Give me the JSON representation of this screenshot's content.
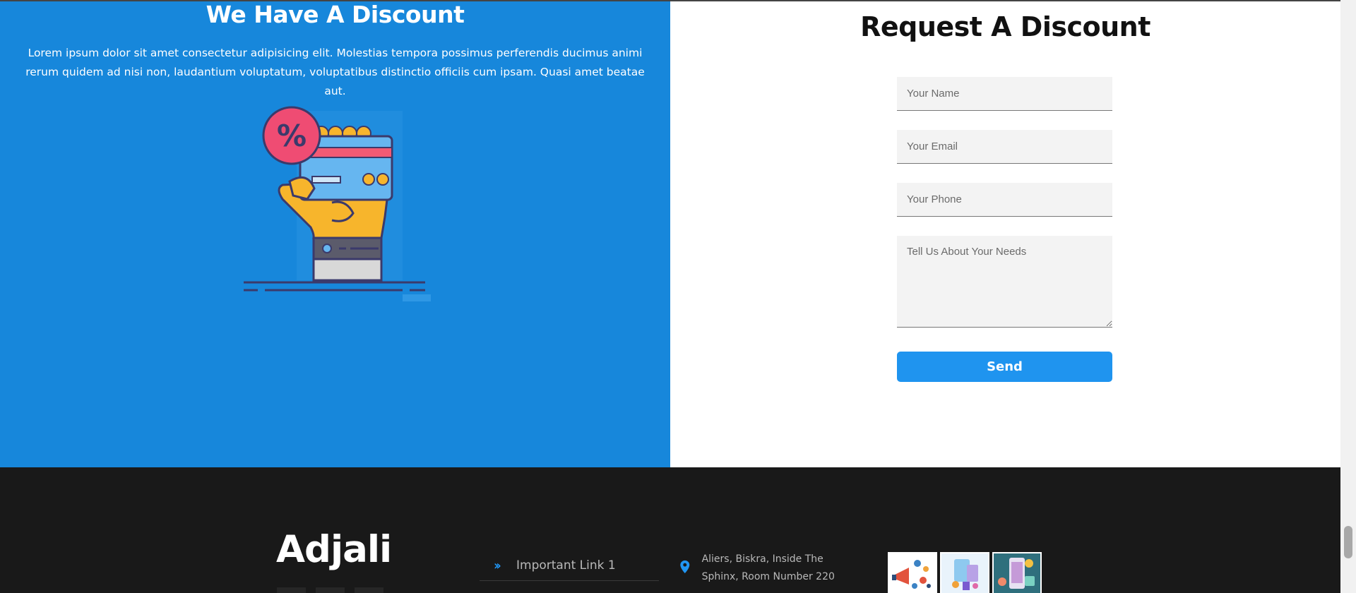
{
  "discount": {
    "title": "We Have A Discount",
    "description": "Lorem ipsum dolor sit amet consectetur adipisicing elit. Molestias tempora possimus perferendis ducimus animi rerum quidem ad nisi non, laudantium voluptatum, voluptatibus distinctio officiis cum ipsam. Quasi amet beatae aut.",
    "illustration_icon": "discount-card-hand-icon",
    "bg_color": "#1787db"
  },
  "request_form": {
    "title": "Request A Discount",
    "name_placeholder": "Your Name",
    "email_placeholder": "Your Email",
    "phone_placeholder": "Your Phone",
    "message_placeholder": "Tell Us About Your Needs",
    "send_label": "Send",
    "button_color": "#1f94ef"
  },
  "footer": {
    "brand": "Adjali",
    "links": [
      {
        "label": "Important Link 1",
        "icon": "double-chevron-right-icon"
      }
    ],
    "contact": {
      "icon": "location-pin-icon",
      "address": "Aliers, Biskra, Inside The Sphinx, Room Number 220"
    },
    "gallery": [
      {
        "icon": "gallery-image-1-icon"
      },
      {
        "icon": "gallery-image-2-icon"
      },
      {
        "icon": "gallery-image-3-icon"
      }
    ],
    "bg_color": "#191919"
  }
}
